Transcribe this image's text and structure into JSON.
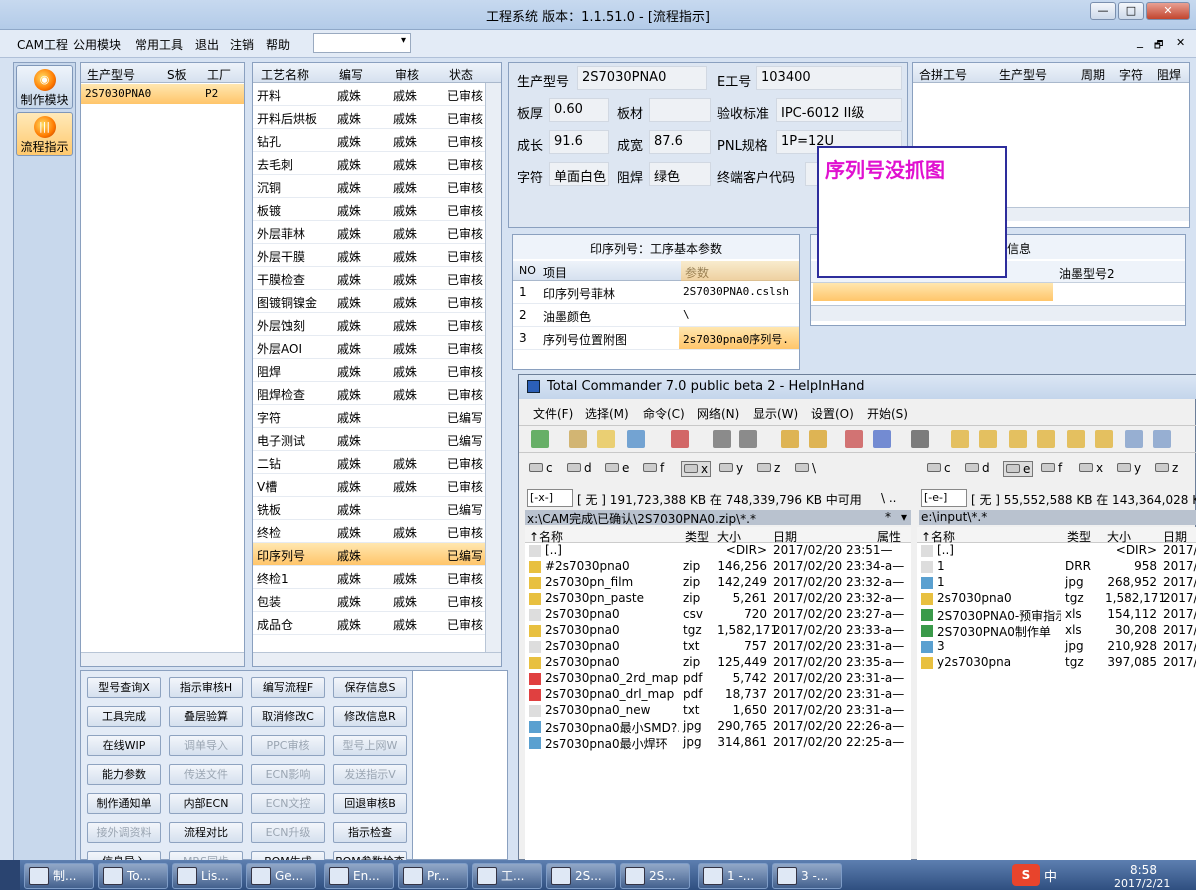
{
  "window": {
    "title": "工程系统   版本：1.1.51.0 - [流程指示]",
    "buttons": [
      "—",
      "□",
      "✕"
    ]
  },
  "menu": {
    "items": [
      "CAM工程",
      "公用模块",
      "常用工具",
      "退出",
      "注销",
      "帮助"
    ],
    "right": [
      "_",
      "🗗",
      "✕"
    ]
  },
  "leftnav": {
    "items": [
      "制作模块",
      "流程指示"
    ]
  },
  "model_panel": {
    "headers": [
      "生产型号",
      "S板",
      "工厂"
    ],
    "row": {
      "model": "2S7030PNA0",
      "factory": "P2"
    }
  },
  "process_panel": {
    "headers": [
      "工艺名称",
      "编写",
      "审核",
      "状态"
    ],
    "rows": [
      [
        "开料",
        "戚姝",
        "戚姝",
        "已审核"
      ],
      [
        "开料后烘板",
        "戚姝",
        "戚姝",
        "已审核"
      ],
      [
        "钻孔",
        "戚姝",
        "戚姝",
        "已审核"
      ],
      [
        "去毛刺",
        "戚姝",
        "戚姝",
        "已审核"
      ],
      [
        "沉铜",
        "戚姝",
        "戚姝",
        "已审核"
      ],
      [
        "板镀",
        "戚姝",
        "戚姝",
        "已审核"
      ],
      [
        "外层菲林",
        "戚姝",
        "戚姝",
        "已审核"
      ],
      [
        "外层干膜",
        "戚姝",
        "戚姝",
        "已审核"
      ],
      [
        "干膜检查",
        "戚姝",
        "戚姝",
        "已审核"
      ],
      [
        "图镀铜镍金",
        "戚姝",
        "戚姝",
        "已审核"
      ],
      [
        "外层蚀刻",
        "戚姝",
        "戚姝",
        "已审核"
      ],
      [
        "外层AOI",
        "戚姝",
        "戚姝",
        "已审核"
      ],
      [
        "阻焊",
        "戚姝",
        "戚姝",
        "已审核"
      ],
      [
        "阻焊检查",
        "戚姝",
        "戚姝",
        "已审核"
      ],
      [
        "字符",
        "戚姝",
        "",
        "已编写"
      ],
      [
        "电子测试",
        "戚姝",
        "",
        "已编写"
      ],
      [
        "二钻",
        "戚姝",
        "戚姝",
        "已审核"
      ],
      [
        "V槽",
        "戚姝",
        "戚姝",
        "已审核"
      ],
      [
        "铣板",
        "戚姝",
        "",
        "已编写"
      ],
      [
        "终检",
        "戚姝",
        "戚姝",
        "已审核"
      ],
      [
        "印序列号",
        "戚姝",
        "",
        "已编写"
      ],
      [
        "终检1",
        "戚姝",
        "戚姝",
        "已审核"
      ],
      [
        "包装",
        "戚姝",
        "戚姝",
        "已审核"
      ],
      [
        "成品仓",
        "戚姝",
        "戚姝",
        "已审核"
      ]
    ],
    "selected_index": 20
  },
  "buttons": [
    [
      "型号查询X",
      "指示审核H",
      "编写流程F",
      "保存信息S"
    ],
    [
      "工具完成",
      "叠层验算",
      "取消修改C",
      "修改信息R"
    ],
    [
      "在线WIP",
      "调单导入",
      "PPC审核",
      "型号上网W"
    ],
    [
      "能力参数",
      "传送文件",
      "ECN影响",
      "发送指示V"
    ],
    [
      "制作通知单",
      "内部ECN",
      "ECN文控",
      "回退审核B"
    ],
    [
      "接外调资料",
      "流程对比",
      "ECN升级",
      "指示检查"
    ],
    [
      "信息导入",
      "MRS同步",
      "BOM生成",
      "BOM参数检查"
    ]
  ],
  "disabled_buttons": [
    "调单导入",
    "PPC审核",
    "型号上网W",
    "传送文件",
    "ECN影响",
    "发送指示V",
    "ECN文控",
    "接外调资料",
    "ECN升级",
    "MRS同步"
  ],
  "info": {
    "model_label": "生产型号",
    "model": "2S7030PNA0",
    "eno_label": "E工号",
    "eno": "103400",
    "thick_label": "板厚",
    "thick": "0.60",
    "mat_label": "板材",
    "mat": "",
    "std_label": "验收标准",
    "std": "IPC-6012 II级",
    "len_label": "成长",
    "len": "91.6",
    "wid_label": "成宽",
    "wid": "87.6",
    "pnl_label": "PNL规格",
    "pnl": "1P=12U",
    "char_label": "字符",
    "char": "单面白色",
    "mask_label": "阻焊",
    "mask": "绿色",
    "cust_label": "终端客户代码",
    "cust": ""
  },
  "merge_panel": {
    "headers": [
      "合拼工号",
      "生产型号",
      "周期",
      "字符",
      "阻焊"
    ]
  },
  "note": "序列号没抓图",
  "param_panel": {
    "title": "印序列号：工序基本参数",
    "headers": [
      "NO",
      "项目",
      "参数"
    ],
    "rows": [
      [
        "1",
        "印序列号菲林",
        "2S7030PNA0.cslsh"
      ],
      [
        "2",
        "油墨颜色",
        "\\"
      ],
      [
        "3",
        "序列号位置附图",
        "2s7030pna0序列号."
      ]
    ]
  },
  "ink_panel": {
    "title_tail": "信息",
    "col": "油墨型号2"
  },
  "tc": {
    "title": "Total Commander 7.0 public beta 2 - HelpInHand",
    "menu": [
      "文件(F)",
      "选择(M)",
      "命令(C)",
      "网络(N)",
      "显示(W)",
      "设置(O)",
      "开始(S)"
    ],
    "left_drives": [
      "c",
      "d",
      "e",
      "f",
      "x",
      "y",
      "z",
      "\\"
    ],
    "right_drives": [
      "c",
      "d",
      "e",
      "f",
      "x",
      "y",
      "z"
    ],
    "left_drive_sel": "[-x-]",
    "left_free": "[ 无 ]  191,723,388 KB 在 748,339,796 KB 中可用",
    "left_path_sep": "\\   ..",
    "left_path": "x:\\CAM完成\\已确认\\2S7030PNA0.zip\\*.*",
    "left_filter": "*",
    "right_drive_sel": "[-e-]",
    "right_free": "[ 无 ]  55,552,588 KB 在 143,364,028 KB",
    "right_path": "e:\\input\\*.*",
    "left_cols": [
      "↑名称",
      "类型",
      "大小",
      "日期",
      "属性"
    ],
    "right_cols": [
      "↑名称",
      "类型",
      "大小",
      "日期"
    ],
    "left_files": [
      [
        "[..]",
        "",
        "<DIR>",
        "2017/02/20 23:51—"
      ],
      [
        "#2s7030pna0",
        "zip",
        "146,256",
        "2017/02/20 23:34-a—"
      ],
      [
        "2s7030pn_film",
        "zip",
        "142,249",
        "2017/02/20 23:32-a—"
      ],
      [
        "2s7030pn_paste",
        "zip",
        "5,261",
        "2017/02/20 23:32-a—"
      ],
      [
        "2s7030pna0",
        "csv",
        "720",
        "2017/02/20 23:27-a—"
      ],
      [
        "2s7030pna0",
        "tgz",
        "1,582,171",
        "2017/02/20 23:33-a—"
      ],
      [
        "2s7030pna0",
        "txt",
        "757",
        "2017/02/20 23:31-a—"
      ],
      [
        "2s7030pna0",
        "zip",
        "125,449",
        "2017/02/20 23:35-a—"
      ],
      [
        "2s7030pna0_2rd_map",
        "pdf",
        "5,742",
        "2017/02/20 23:31-a—"
      ],
      [
        "2s7030pna0_drl_map",
        "pdf",
        "18,737",
        "2017/02/20 23:31-a—"
      ],
      [
        "2s7030pna0_new",
        "txt",
        "1,650",
        "2017/02/20 23:31-a—"
      ],
      [
        "2s7030pna0最小SMD?.",
        "jpg",
        "290,765",
        "2017/02/20 22:26-a—"
      ],
      [
        "2s7030pna0最小焊环",
        "jpg",
        "314,861",
        "2017/02/20 22:25-a—"
      ]
    ],
    "right_files": [
      [
        "[..]",
        "",
        "<DIR>",
        "2017/"
      ],
      [
        "1",
        "DRR",
        "958",
        "2017/"
      ],
      [
        "1",
        "jpg",
        "268,952",
        "2017/"
      ],
      [
        "2s7030pna0",
        "tgz",
        "1,582,171",
        "2017/"
      ],
      [
        "2S7030PNA0-预审指示",
        "xls",
        "154,112",
        "2017/"
      ],
      [
        "2S7030PNA0制作单",
        "xls",
        "30,208",
        "2017/"
      ],
      [
        "3",
        "jpg",
        "210,928",
        "2017/"
      ],
      [
        "y2s7030pna",
        "tgz",
        "397,085",
        "2017/"
      ]
    ]
  },
  "taskbar": {
    "tasks": [
      "制...",
      "To...",
      "Lis...",
      "Ge...",
      "En...",
      "Pr...",
      "工...",
      "2S...",
      "2S...",
      "1 -...",
      "3 -..."
    ],
    "clock": "8:58",
    "date": "2017/2/21",
    "ime": "中"
  }
}
